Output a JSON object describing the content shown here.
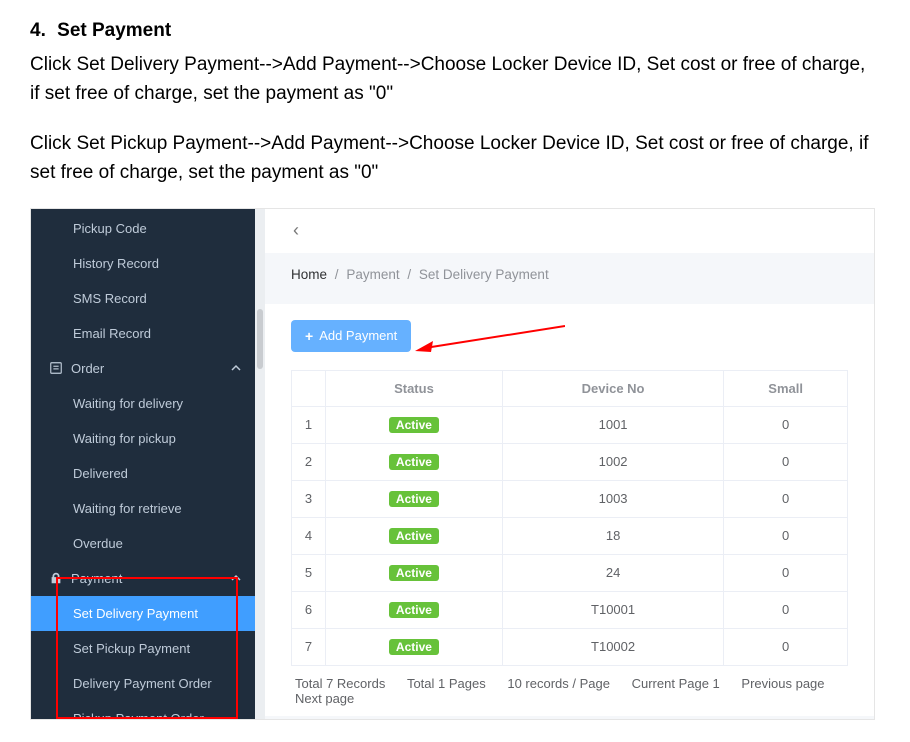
{
  "doc": {
    "heading_num": "4.",
    "heading_text": "Set Payment",
    "para1": "Click Set Delivery Payment-->Add Payment-->Choose Locker Device ID, Set cost or free of charge, if set free of charge, set the payment as \"0\"",
    "para2": "Click Set Pickup Payment-->Add Payment-->Choose Locker Device ID, Set cost or free of charge, if set free of charge, set the payment as \"0\""
  },
  "sidebar": {
    "items_top": [
      "Pickup Code",
      "History Record",
      "SMS Record",
      "Email Record"
    ],
    "section_order": "Order",
    "items_order": [
      "Waiting for delivery",
      "Waiting for pickup",
      "Delivered",
      "Waiting for retrieve",
      "Overdue"
    ],
    "section_payment": "Payment",
    "items_payment": [
      "Set Delivery Payment",
      "Set Pickup Payment",
      "Delivery Payment Order",
      "Pickup Payment Order"
    ]
  },
  "breadcrumb": {
    "home": "Home",
    "seg1": "Payment",
    "seg2": "Set Delivery Payment",
    "sep": "/"
  },
  "button": {
    "add": "Add Payment",
    "plus": "+"
  },
  "table": {
    "headers": [
      "",
      "Status",
      "Device No",
      "Small"
    ],
    "rows": [
      {
        "idx": "1",
        "status": "Active",
        "device": "1001",
        "small": "0"
      },
      {
        "idx": "2",
        "status": "Active",
        "device": "1002",
        "small": "0"
      },
      {
        "idx": "3",
        "status": "Active",
        "device": "1003",
        "small": "0"
      },
      {
        "idx": "4",
        "status": "Active",
        "device": "18",
        "small": "0"
      },
      {
        "idx": "5",
        "status": "Active",
        "device": "24",
        "small": "0"
      },
      {
        "idx": "6",
        "status": "Active",
        "device": "T10001",
        "small": "0"
      },
      {
        "idx": "7",
        "status": "Active",
        "device": "T10002",
        "small": "0"
      }
    ]
  },
  "pager": {
    "total_records": "Total 7 Records",
    "total_pages": "Total 1 Pages",
    "per_page": "10 records / Page",
    "current": "Current Page 1",
    "prev": "Previous page",
    "next": "Next page"
  }
}
